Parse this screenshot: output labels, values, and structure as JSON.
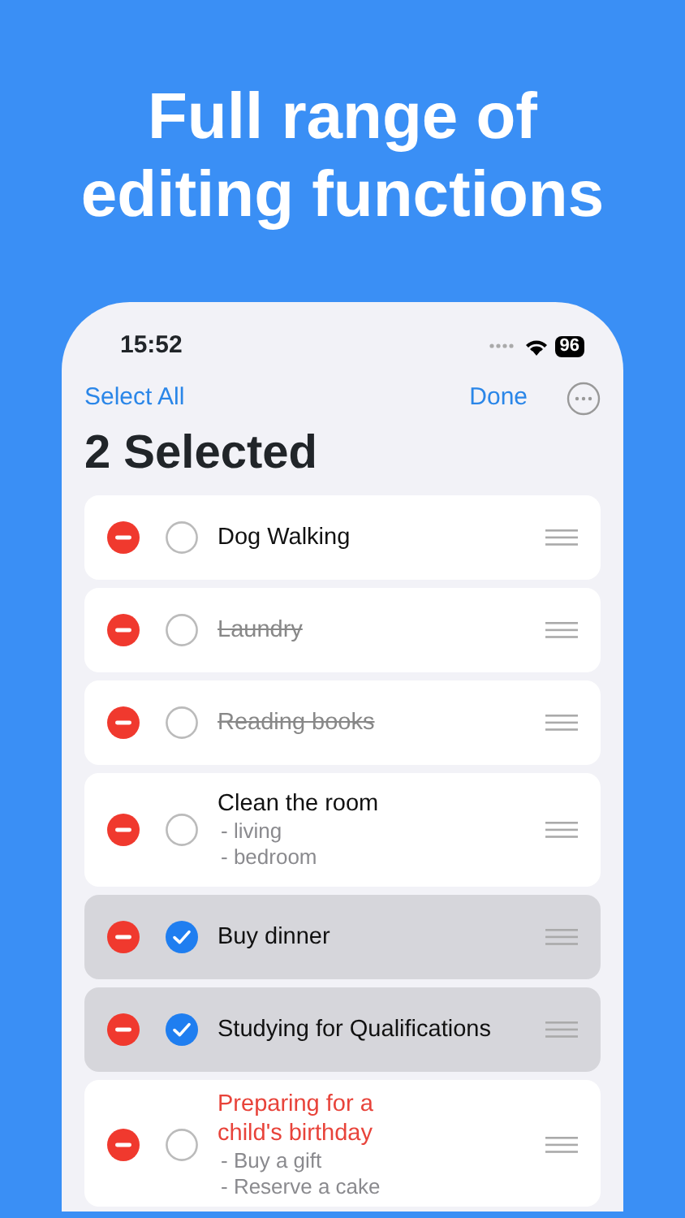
{
  "headline": "Full range of editing functions",
  "status_bar": {
    "time": "15:52",
    "battery": "96"
  },
  "nav": {
    "left": "Select All",
    "right": "Done"
  },
  "title": "2 Selected",
  "tasks": [
    {
      "title": "Dog Walking",
      "done": false,
      "selected": false,
      "overdue": false
    },
    {
      "title": "Laundry",
      "done": true,
      "selected": false,
      "overdue": false
    },
    {
      "title": "Reading books",
      "done": true,
      "selected": false,
      "overdue": false
    },
    {
      "title": "Clean the room",
      "done": false,
      "selected": false,
      "overdue": false,
      "notes": [
        "- living",
        "- bedroom"
      ]
    },
    {
      "title": "Buy dinner",
      "done": false,
      "selected": true,
      "overdue": false
    },
    {
      "title": "Studying for Qualifications",
      "done": false,
      "selected": true,
      "overdue": false
    },
    {
      "title": "Preparing for a child's birthday",
      "done": false,
      "selected": false,
      "overdue": true,
      "notes": [
        "- Buy a gift",
        "- Reserve a cake"
      ]
    }
  ]
}
